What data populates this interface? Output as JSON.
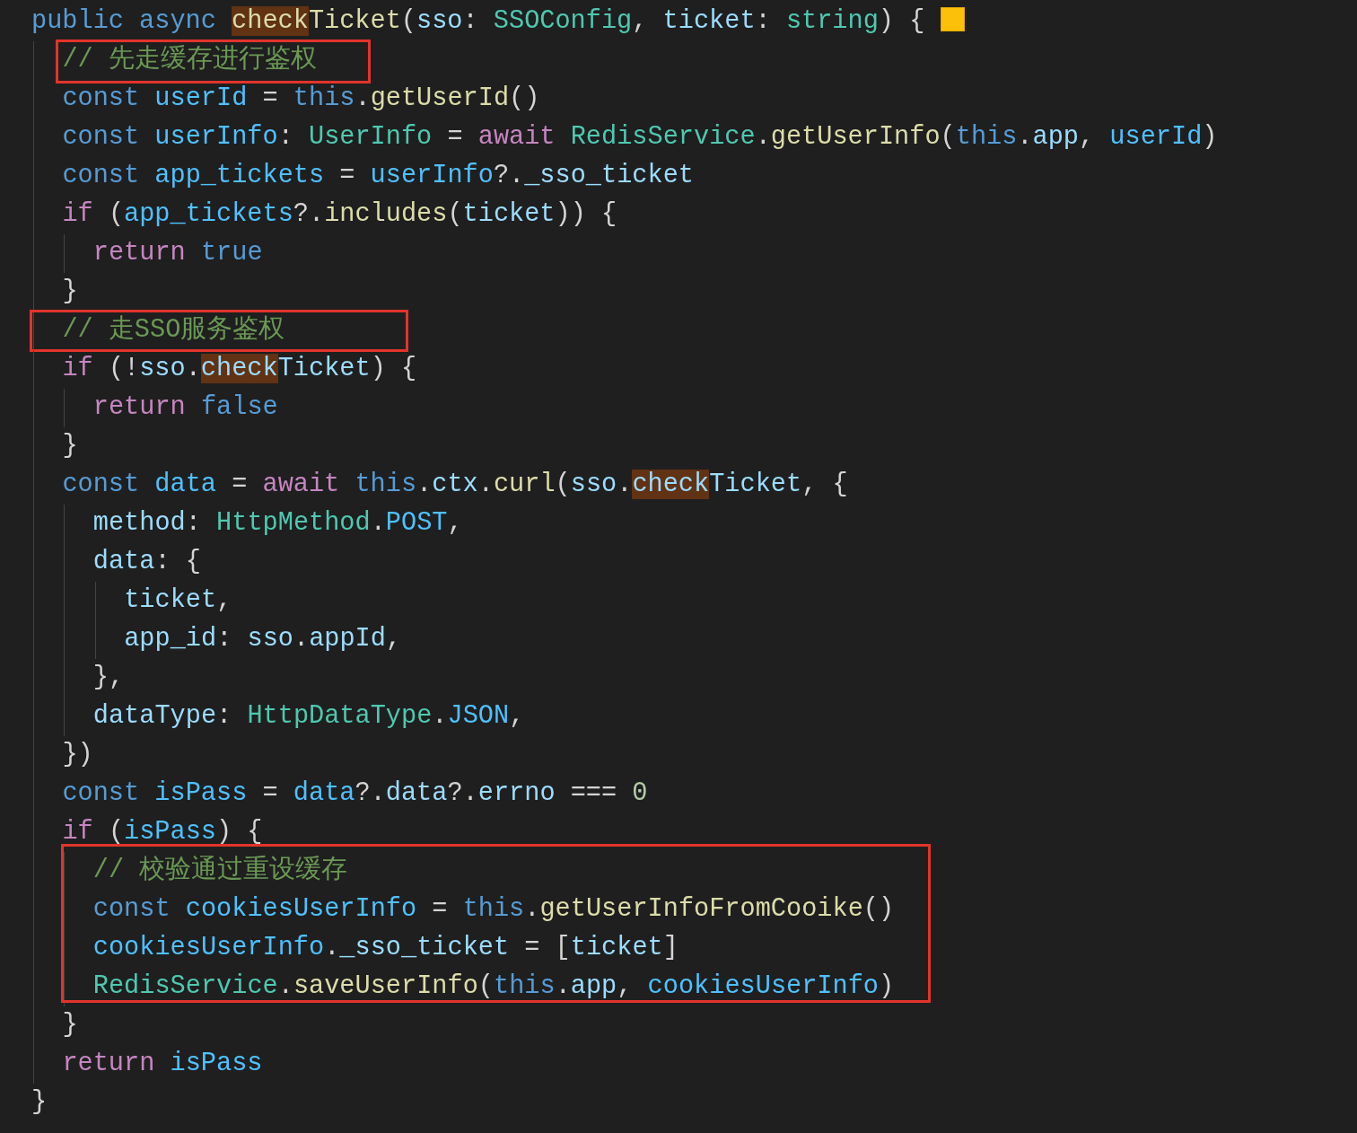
{
  "code": [
    {
      "kind": "line",
      "tokens": [
        {
          "kind": "kw",
          "text": "public async "
        },
        {
          "kind": "fn-match",
          "text": "check"
        },
        {
          "kind": "fn",
          "text": "Ticket"
        },
        {
          "kind": "p",
          "text": "("
        },
        {
          "kind": "var",
          "text": "sso"
        },
        {
          "kind": "p",
          "text": ": "
        },
        {
          "kind": "type",
          "text": "SSOConfig"
        },
        {
          "kind": "p",
          "text": ", "
        },
        {
          "kind": "var",
          "text": "ticket"
        },
        {
          "kind": "p",
          "text": ": "
        },
        {
          "kind": "type",
          "text": "string"
        },
        {
          "kind": "p",
          "text": ") {"
        }
      ],
      "children": [
        {
          "kind": "box",
          "lines": [
            {
              "kind": "line",
              "tokens": [
                {
                  "kind": "cmt",
                  "text": "// 先走缓存进行鉴权"
                }
              ]
            }
          ]
        },
        {
          "kind": "line",
          "tokens": [
            {
              "kind": "kw",
              "text": "const "
            },
            {
              "kind": "const",
              "text": "userId"
            },
            {
              "kind": "p",
              "text": " = "
            },
            {
              "kind": "kw",
              "text": "this"
            },
            {
              "kind": "p",
              "text": "."
            },
            {
              "kind": "fn",
              "text": "getUserId"
            },
            {
              "kind": "p",
              "text": "()"
            }
          ]
        },
        {
          "kind": "line",
          "tokens": [
            {
              "kind": "kw",
              "text": "const "
            },
            {
              "kind": "const",
              "text": "userInfo"
            },
            {
              "kind": "p",
              "text": ": "
            },
            {
              "kind": "type",
              "text": "UserInfo"
            },
            {
              "kind": "p",
              "text": " = "
            },
            {
              "kind": "ctl",
              "text": "await "
            },
            {
              "kind": "type",
              "text": "RedisService"
            },
            {
              "kind": "p",
              "text": "."
            },
            {
              "kind": "fn",
              "text": "getUserInfo"
            },
            {
              "kind": "p",
              "text": "("
            },
            {
              "kind": "kw",
              "text": "this"
            },
            {
              "kind": "p",
              "text": "."
            },
            {
              "kind": "var",
              "text": "app"
            },
            {
              "kind": "p",
              "text": ", "
            },
            {
              "kind": "const",
              "text": "userId"
            },
            {
              "kind": "p",
              "text": ")"
            }
          ]
        },
        {
          "kind": "line",
          "tokens": [
            {
              "kind": "kw",
              "text": "const "
            },
            {
              "kind": "const",
              "text": "app_tickets"
            },
            {
              "kind": "p",
              "text": " = "
            },
            {
              "kind": "const",
              "text": "userInfo"
            },
            {
              "kind": "p",
              "text": "?."
            },
            {
              "kind": "var",
              "text": "_sso_ticket"
            }
          ]
        },
        {
          "kind": "line",
          "tokens": [
            {
              "kind": "ctl",
              "text": "if "
            },
            {
              "kind": "p",
              "text": "("
            },
            {
              "kind": "const",
              "text": "app_tickets"
            },
            {
              "kind": "p",
              "text": "?."
            },
            {
              "kind": "fn",
              "text": "includes"
            },
            {
              "kind": "p",
              "text": "("
            },
            {
              "kind": "var",
              "text": "ticket"
            },
            {
              "kind": "p",
              "text": ")) {"
            }
          ],
          "children": [
            {
              "kind": "line",
              "tokens": [
                {
                  "kind": "ctl",
                  "text": "return "
                },
                {
                  "kind": "kw",
                  "text": "true"
                }
              ]
            }
          ]
        },
        {
          "kind": "line",
          "tokens": [
            {
              "kind": "p",
              "text": "}"
            }
          ]
        },
        {
          "kind": "box",
          "lines": [
            {
              "kind": "line",
              "tokens": [
                {
                  "kind": "cmt",
                  "text": "// 走SSO服务鉴权"
                }
              ]
            }
          ]
        },
        {
          "kind": "line",
          "tokens": [
            {
              "kind": "ctl",
              "text": "if "
            },
            {
              "kind": "p",
              "text": "(!"
            },
            {
              "kind": "var",
              "text": "sso"
            },
            {
              "kind": "p",
              "text": "."
            },
            {
              "kind": "var-match",
              "text": "check"
            },
            {
              "kind": "var",
              "text": "Ticket"
            },
            {
              "kind": "p",
              "text": ") {"
            }
          ],
          "children": [
            {
              "kind": "line",
              "tokens": [
                {
                  "kind": "ctl",
                  "text": "return "
                },
                {
                  "kind": "kw",
                  "text": "false"
                }
              ]
            }
          ]
        },
        {
          "kind": "line",
          "tokens": [
            {
              "kind": "p",
              "text": "}"
            }
          ]
        },
        {
          "kind": "line",
          "tokens": [
            {
              "kind": "kw",
              "text": "const "
            },
            {
              "kind": "const",
              "text": "data"
            },
            {
              "kind": "p",
              "text": " = "
            },
            {
              "kind": "ctl",
              "text": "await "
            },
            {
              "kind": "kw",
              "text": "this"
            },
            {
              "kind": "p",
              "text": "."
            },
            {
              "kind": "var",
              "text": "ctx"
            },
            {
              "kind": "p",
              "text": "."
            },
            {
              "kind": "fn",
              "text": "curl"
            },
            {
              "kind": "p",
              "text": "("
            },
            {
              "kind": "var",
              "text": "sso"
            },
            {
              "kind": "p",
              "text": "."
            },
            {
              "kind": "var-match",
              "text": "check"
            },
            {
              "kind": "var",
              "text": "Ticket"
            },
            {
              "kind": "p",
              "text": ", {"
            }
          ],
          "children": [
            {
              "kind": "line",
              "tokens": [
                {
                  "kind": "var",
                  "text": "method"
                },
                {
                  "kind": "p",
                  "text": ": "
                },
                {
                  "kind": "type",
                  "text": "HttpMethod"
                },
                {
                  "kind": "p",
                  "text": "."
                },
                {
                  "kind": "enum",
                  "text": "POST"
                },
                {
                  "kind": "p",
                  "text": ","
                }
              ]
            },
            {
              "kind": "line",
              "tokens": [
                {
                  "kind": "var",
                  "text": "data"
                },
                {
                  "kind": "p",
                  "text": ": {"
                }
              ],
              "children": [
                {
                  "kind": "line",
                  "tokens": [
                    {
                      "kind": "var",
                      "text": "ticket"
                    },
                    {
                      "kind": "p",
                      "text": ","
                    }
                  ]
                },
                {
                  "kind": "line",
                  "tokens": [
                    {
                      "kind": "var",
                      "text": "app_id"
                    },
                    {
                      "kind": "p",
                      "text": ": "
                    },
                    {
                      "kind": "var",
                      "text": "sso"
                    },
                    {
                      "kind": "p",
                      "text": "."
                    },
                    {
                      "kind": "var",
                      "text": "appId"
                    },
                    {
                      "kind": "p",
                      "text": ","
                    }
                  ]
                }
              ]
            },
            {
              "kind": "line",
              "tokens": [
                {
                  "kind": "p",
                  "text": "},"
                }
              ]
            },
            {
              "kind": "line",
              "tokens": [
                {
                  "kind": "var",
                  "text": "dataType"
                },
                {
                  "kind": "p",
                  "text": ": "
                },
                {
                  "kind": "type",
                  "text": "HttpDataType"
                },
                {
                  "kind": "p",
                  "text": "."
                },
                {
                  "kind": "enum",
                  "text": "JSON"
                },
                {
                  "kind": "p",
                  "text": ","
                }
              ]
            }
          ]
        },
        {
          "kind": "line",
          "tokens": [
            {
              "kind": "p",
              "text": "})"
            }
          ]
        },
        {
          "kind": "line",
          "tokens": [
            {
              "kind": "kw",
              "text": "const "
            },
            {
              "kind": "const",
              "text": "isPass"
            },
            {
              "kind": "p",
              "text": " = "
            },
            {
              "kind": "const",
              "text": "data"
            },
            {
              "kind": "p",
              "text": "?."
            },
            {
              "kind": "var",
              "text": "data"
            },
            {
              "kind": "p",
              "text": "?."
            },
            {
              "kind": "var",
              "text": "errno"
            },
            {
              "kind": "p",
              "text": " === "
            },
            {
              "kind": "num",
              "text": "0"
            }
          ]
        },
        {
          "kind": "line",
          "tokens": [
            {
              "kind": "ctl",
              "text": "if "
            },
            {
              "kind": "p",
              "text": "("
            },
            {
              "kind": "const",
              "text": "isPass"
            },
            {
              "kind": "p",
              "text": ") {"
            }
          ],
          "children": [
            {
              "kind": "box",
              "lines": [
                {
                  "kind": "line",
                  "tokens": [
                    {
                      "kind": "cmt",
                      "text": "// 校验通过重设缓存"
                    }
                  ]
                },
                {
                  "kind": "line",
                  "tokens": [
                    {
                      "kind": "kw",
                      "text": "const "
                    },
                    {
                      "kind": "const",
                      "text": "cookiesUserInfo"
                    },
                    {
                      "kind": "p",
                      "text": " = "
                    },
                    {
                      "kind": "kw",
                      "text": "this"
                    },
                    {
                      "kind": "p",
                      "text": "."
                    },
                    {
                      "kind": "fn",
                      "text": "getUserInfoFromCooike"
                    },
                    {
                      "kind": "p",
                      "text": "()"
                    }
                  ]
                },
                {
                  "kind": "line",
                  "tokens": [
                    {
                      "kind": "const",
                      "text": "cookiesUserInfo"
                    },
                    {
                      "kind": "p",
                      "text": "."
                    },
                    {
                      "kind": "var",
                      "text": "_sso_ticket"
                    },
                    {
                      "kind": "p",
                      "text": " = ["
                    },
                    {
                      "kind": "var",
                      "text": "ticket"
                    },
                    {
                      "kind": "p",
                      "text": "]"
                    }
                  ]
                },
                {
                  "kind": "line",
                  "tokens": [
                    {
                      "kind": "type",
                      "text": "RedisService"
                    },
                    {
                      "kind": "p",
                      "text": "."
                    },
                    {
                      "kind": "fn",
                      "text": "saveUserInfo"
                    },
                    {
                      "kind": "p",
                      "text": "("
                    },
                    {
                      "kind": "kw",
                      "text": "this"
                    },
                    {
                      "kind": "p",
                      "text": "."
                    },
                    {
                      "kind": "var",
                      "text": "app"
                    },
                    {
                      "kind": "p",
                      "text": ", "
                    },
                    {
                      "kind": "const",
                      "text": "cookiesUserInfo"
                    },
                    {
                      "kind": "p",
                      "text": ")"
                    }
                  ]
                }
              ]
            }
          ]
        },
        {
          "kind": "line",
          "tokens": [
            {
              "kind": "p",
              "text": "}"
            }
          ]
        },
        {
          "kind": "line",
          "tokens": [
            {
              "kind": "ctl",
              "text": "return "
            },
            {
              "kind": "const",
              "text": "isPass"
            }
          ]
        }
      ]
    },
    {
      "kind": "line",
      "tokens": [
        {
          "kind": "p",
          "text": "}"
        }
      ]
    }
  ]
}
